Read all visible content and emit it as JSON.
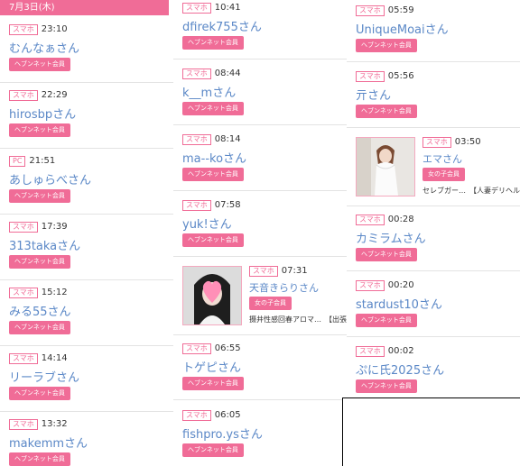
{
  "columns": [
    {
      "date_header": "7月3日(木)",
      "entries": [
        {
          "device": "スマホ",
          "time": "23:10",
          "name": "むんなぁさん",
          "badge": "ヘブンネット会員"
        },
        {
          "device": "スマホ",
          "time": "22:29",
          "name": "hirosbpさん",
          "badge": "ヘブンネット会員"
        },
        {
          "device": "PC",
          "time": "21:51",
          "name": "あしゅらべさん",
          "badge": "ヘブンネット会員"
        },
        {
          "device": "スマホ",
          "time": "17:39",
          "name": "313takaさん",
          "badge": "ヘブンネット会員"
        },
        {
          "device": "スマホ",
          "time": "15:12",
          "name": "みる55さん",
          "badge": "ヘブンネット会員"
        },
        {
          "device": "スマホ",
          "time": "14:14",
          "name": "リーラブさん",
          "badge": "ヘブンネット会員"
        },
        {
          "device": "スマホ",
          "time": "13:32",
          "name": "makemmさん",
          "badge": "ヘブンネット会員"
        }
      ]
    },
    {
      "entries": [
        {
          "device": "スマホ",
          "time": "10:41",
          "name": "dfirek755さん",
          "badge": "ヘブンネット会員"
        },
        {
          "device": "スマホ",
          "time": "08:44",
          "name": "k__mさん",
          "badge": "ヘブンネット会員"
        },
        {
          "device": "スマホ",
          "time": "08:14",
          "name": "ma--koさん",
          "badge": "ヘブンネット会員"
        },
        {
          "device": "スマホ",
          "time": "07:58",
          "name": "yuk!さん",
          "badge": "ヘブンネット会員"
        },
        {
          "device": "スマホ",
          "time": "07:31",
          "name": "天音きらりさん",
          "badge": "女の子会員",
          "desc": "摄井性感回春アロマ…　【出張"
        },
        {
          "device": "スマホ",
          "time": "06:55",
          "name": "トゲピさん",
          "badge": "ヘブンネット会員"
        },
        {
          "device": "スマホ",
          "time": "06:05",
          "name": "fishpro.ysさん",
          "badge": "ヘブンネット会員"
        }
      ]
    },
    {
      "entries": [
        {
          "device": "スマホ",
          "time": "05:59",
          "name": "UniqueMoaiさん",
          "badge": "ヘブンネット会員"
        },
        {
          "device": "スマホ",
          "time": "05:56",
          "name": "亓さん",
          "badge": "ヘブンネット会員"
        },
        {
          "device": "スマホ",
          "time": "03:50",
          "name": "エマさん",
          "badge": "女の子会員",
          "desc": "セレブガー…　【人妻デリヘル"
        },
        {
          "device": "スマホ",
          "time": "00:28",
          "name": "カミラムさん",
          "badge": "ヘブンネット会員"
        },
        {
          "device": "スマホ",
          "time": "00:20",
          "name": "stardust10さん",
          "badge": "ヘブンネット会員"
        },
        {
          "device": "スマホ",
          "time": "00:02",
          "name": "ぷに氏2025さん",
          "badge": "ヘブンネット会員"
        }
      ]
    }
  ],
  "colors": {
    "accent": "#f06c97",
    "name": "#5b88c7"
  }
}
